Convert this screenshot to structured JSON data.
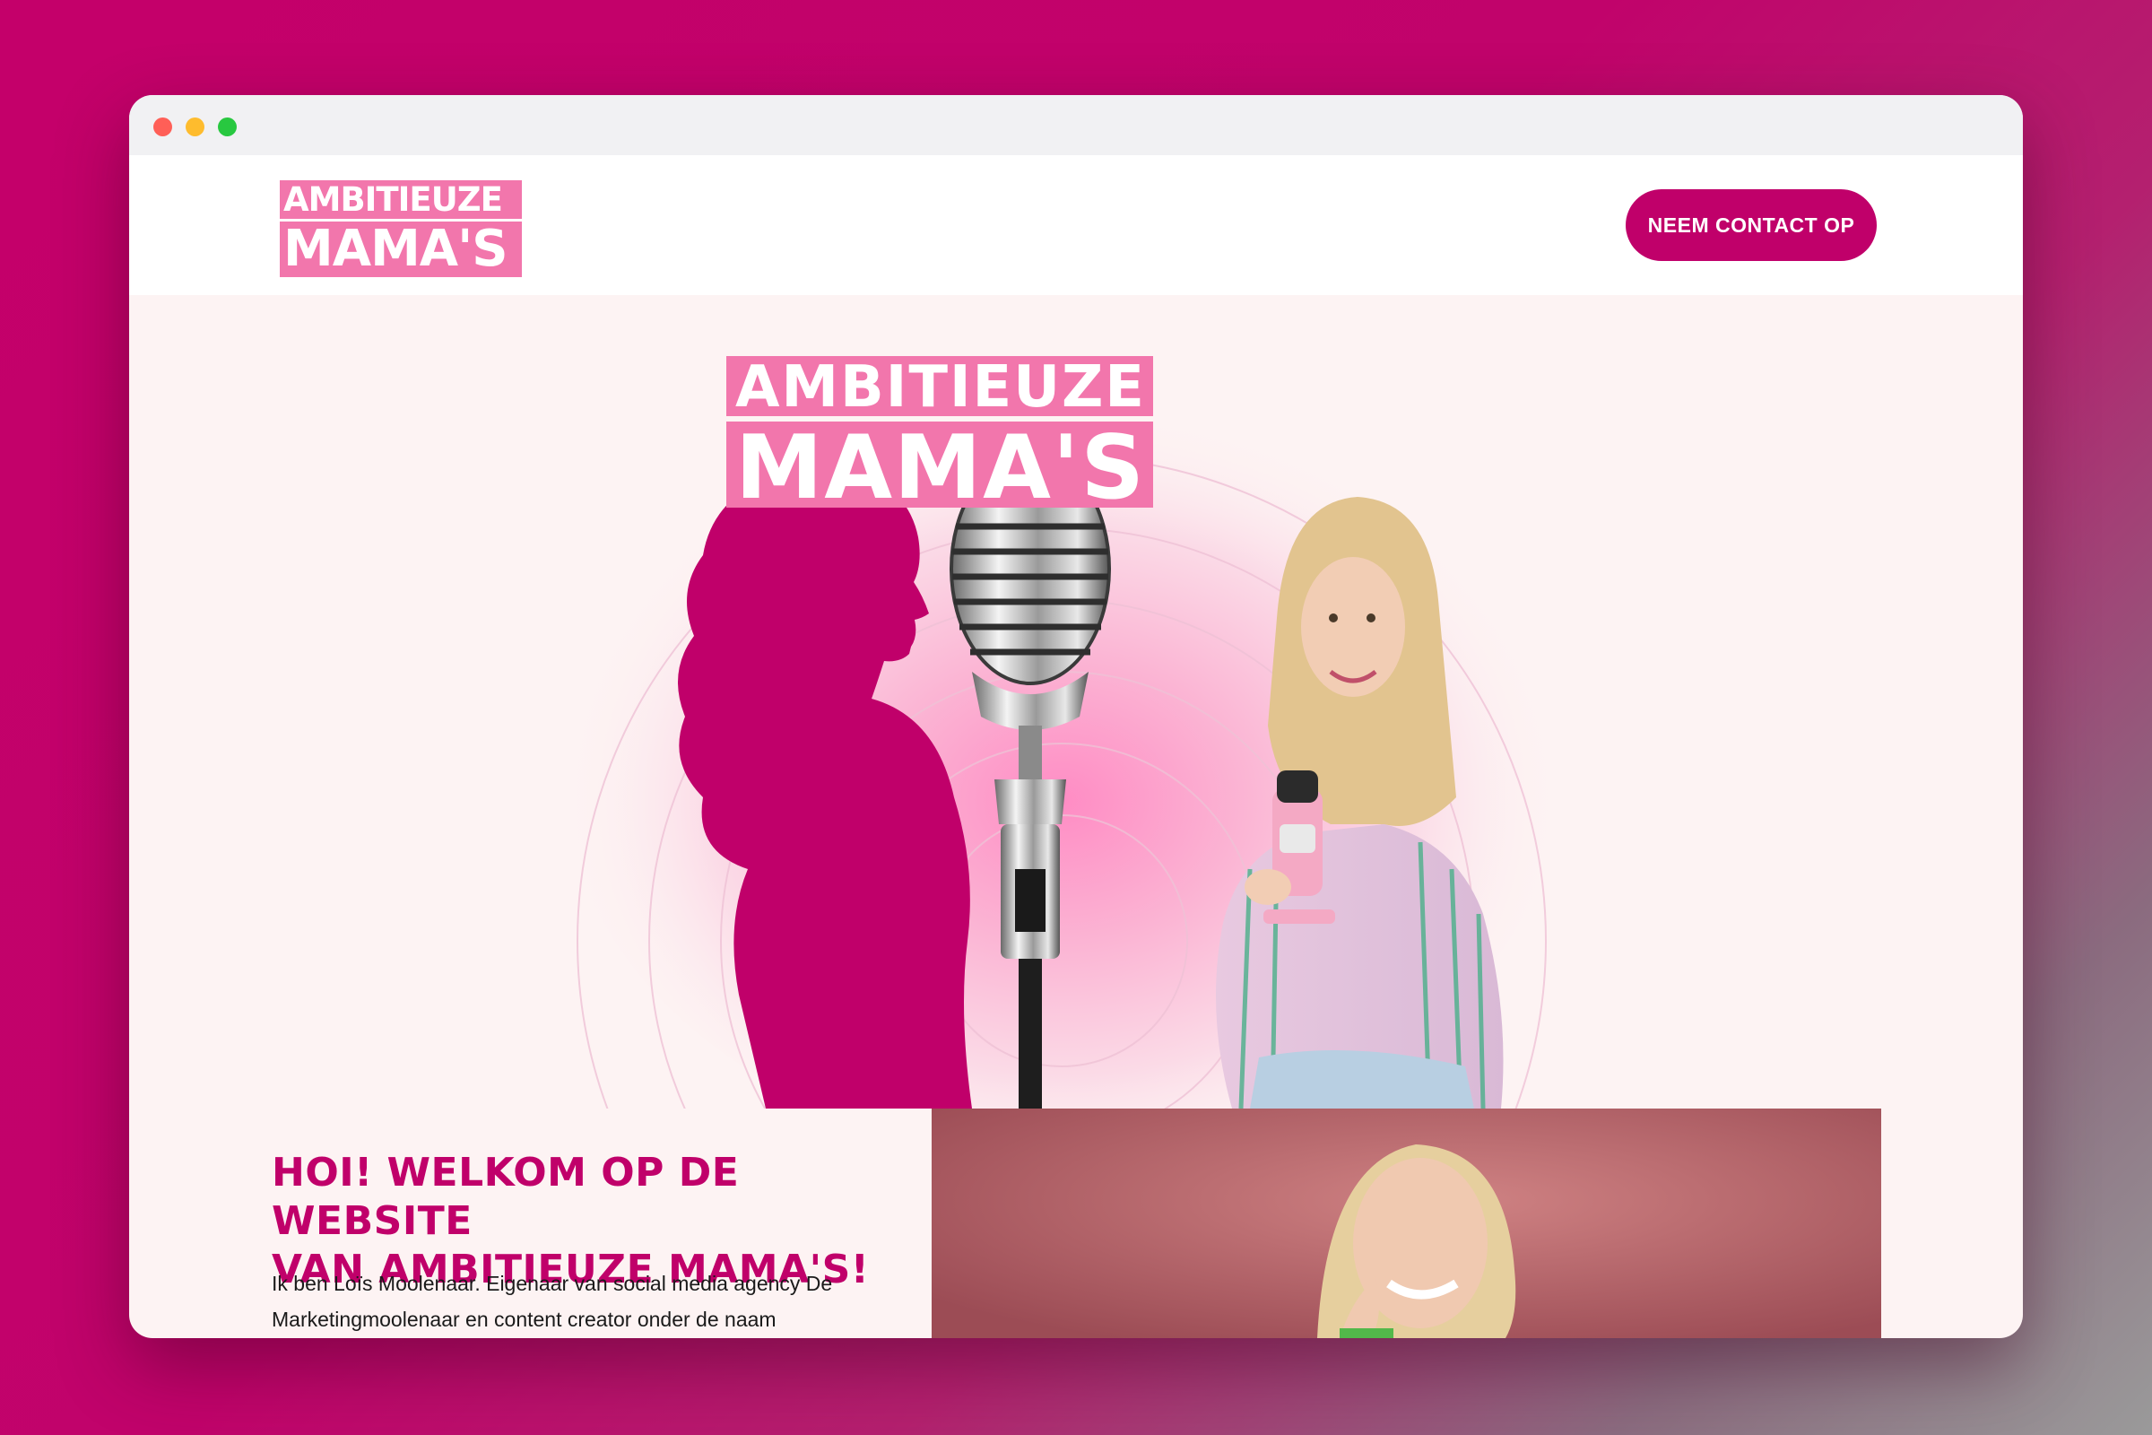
{
  "window": {
    "traffic_lights": [
      "close",
      "minimize",
      "maximize"
    ]
  },
  "header": {
    "logo_line1": "AMBITIEUZE",
    "logo_line2": "MAMA'S",
    "contact_button": "NEEM CONTACT OP"
  },
  "hero": {
    "logo_line1": "AMBITIEUZE",
    "logo_line2": "MAMA'S"
  },
  "content": {
    "welcome_line1": "HOI! WELKOM OP DE WEBSITE",
    "welcome_line2": "VAN AMBITIEUZE MAMA'S!",
    "intro_line1": "Ik ben Loïs Moolenaar. Eigenaar van social media agency De",
    "intro_line2": "Marketingmoolenaar en content creator onder de naam"
  },
  "colors": {
    "brand": "#c0006a",
    "logo_pink": "#f276ac",
    "page_bg": "#fdf3f3"
  }
}
